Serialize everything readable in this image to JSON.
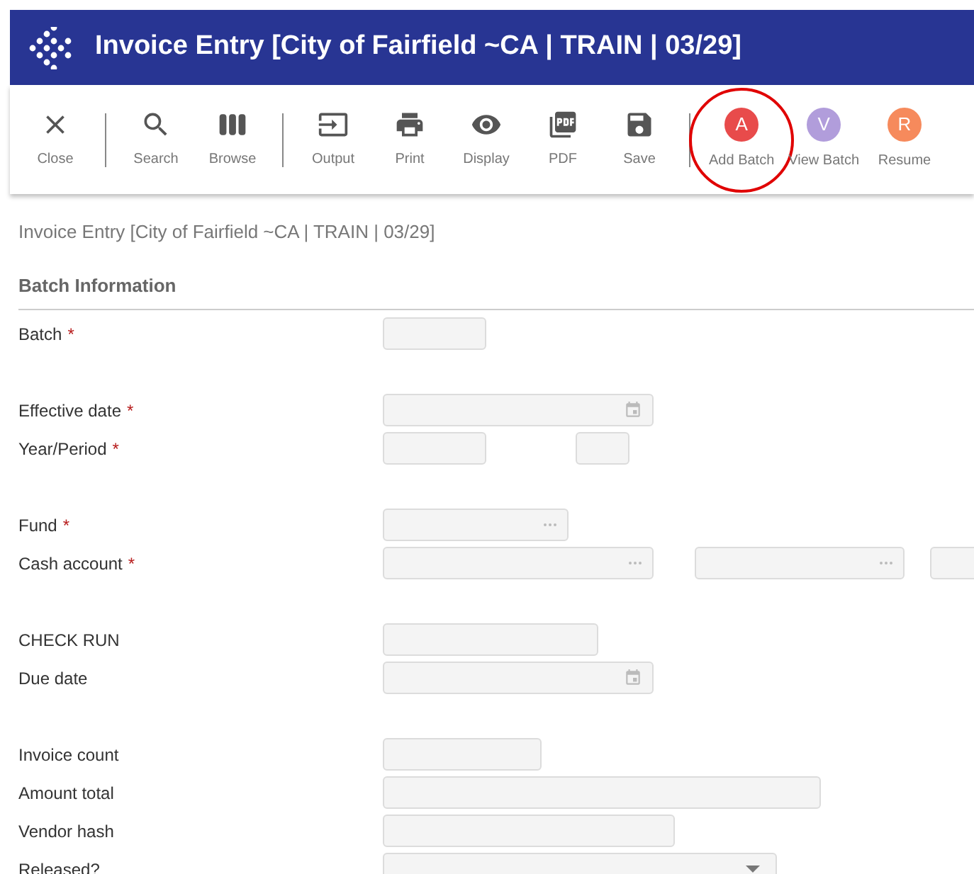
{
  "window": {
    "title": "Invoice Entry [City of Fairfield ~CA | TRAIN | 03/29]"
  },
  "toolbar": {
    "items": [
      {
        "label": "Close",
        "kind": "icon",
        "divider_after": true
      },
      {
        "label": "Search",
        "kind": "icon",
        "divider_after": false
      },
      {
        "label": "Browse",
        "kind": "icon",
        "divider_after": true
      },
      {
        "label": "Output",
        "kind": "icon",
        "divider_after": false
      },
      {
        "label": "Print",
        "kind": "icon",
        "divider_after": false
      },
      {
        "label": "Display",
        "kind": "icon",
        "divider_after": false
      },
      {
        "label": "PDF",
        "kind": "icon",
        "divider_after": false
      },
      {
        "label": "Save",
        "kind": "icon",
        "divider_after": true
      },
      {
        "label": "Add Batch",
        "kind": "letter",
        "letter": "A",
        "color": "#e84b4b",
        "highlighted": true
      },
      {
        "label": "View Batch",
        "kind": "letter",
        "letter": "V",
        "color": "#b19ddb",
        "highlighted": false
      },
      {
        "label": "Resume",
        "kind": "letter",
        "letter": "R",
        "color": "#f68a5c",
        "highlighted": false
      }
    ]
  },
  "breadcrumb": "Invoice Entry [City of Fairfield ~CA | TRAIN | 03/29]",
  "section": {
    "title": "Batch Information"
  },
  "groups": [
    [
      {
        "label": "Batch",
        "required_mark": "*",
        "fields": [
          {
            "kind": "text"
          }
        ]
      }
    ],
    [
      {
        "label": "Effective date",
        "required_mark": "*",
        "fields": [
          {
            "kind": "date"
          }
        ]
      },
      {
        "label": "Year/Period",
        "required_mark": "*",
        "fields": [
          {
            "kind": "text"
          },
          {
            "kind": "text"
          }
        ]
      }
    ],
    [
      {
        "label": "Fund",
        "required_mark": "*",
        "fields": [
          {
            "kind": "lookup"
          }
        ]
      },
      {
        "label": "Cash account",
        "required_mark": "*",
        "fields": [
          {
            "kind": "lookup"
          },
          {
            "kind": "lookup"
          },
          {
            "kind": "text"
          }
        ]
      }
    ],
    [
      {
        "label": "CHECK RUN",
        "fields": [
          {
            "kind": "text"
          }
        ]
      },
      {
        "label": "Due date",
        "fields": [
          {
            "kind": "date"
          }
        ]
      }
    ],
    [
      {
        "label": "Invoice count",
        "fields": [
          {
            "kind": "text"
          }
        ]
      },
      {
        "label": "Amount total",
        "fields": [
          {
            "kind": "text"
          }
        ]
      },
      {
        "label": "Vendor hash",
        "fields": [
          {
            "kind": "text"
          }
        ]
      },
      {
        "label": "Released?",
        "fields": [
          {
            "kind": "select"
          }
        ]
      }
    ]
  ]
}
